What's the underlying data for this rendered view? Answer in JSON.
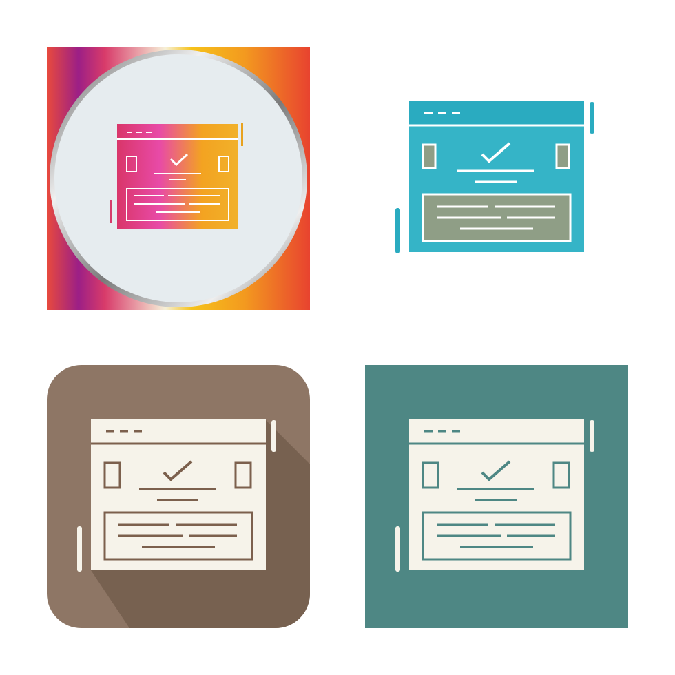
{
  "icon_set": {
    "icon_name": "webpage-verified-icon",
    "variants": [
      {
        "id": "gradient",
        "style": "gradient-circle",
        "colors": {
          "frame_start": "#e8403f",
          "frame_mid": "#9b1f7f",
          "frame_mid2": "#f2c618",
          "circle": "#e6ecef",
          "ring": "#8a8a8a"
        }
      },
      {
        "id": "flat",
        "style": "flat-color",
        "colors": {
          "header": "#2aabc0",
          "body": "#35b4c7",
          "panel": "#8f9e86",
          "line": "#ffffff"
        }
      },
      {
        "id": "brown",
        "style": "long-shadow-rounded",
        "colors": {
          "background": "#8e7665",
          "shadow": "#776150",
          "icon": "#f6f3ea",
          "line": "#7c604d"
        }
      },
      {
        "id": "teal",
        "style": "square-glyph",
        "colors": {
          "background": "#4e8784",
          "icon": "#f6f3ea",
          "line": "#4e8784"
        }
      }
    ]
  }
}
